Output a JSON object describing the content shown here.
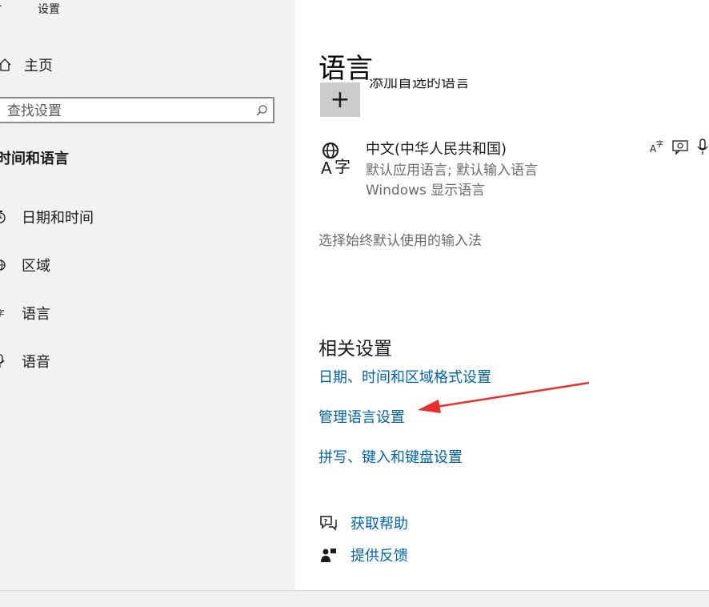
{
  "window": {
    "title": "设置"
  },
  "sidebar": {
    "home_label": "主页",
    "search_placeholder": "查找设置",
    "section_title": "时间和语言",
    "items": [
      {
        "label": "日期和时间",
        "icon": "clock-icon"
      },
      {
        "label": "区域",
        "icon": "globe-icon"
      },
      {
        "label": "语言",
        "icon": "language-icon"
      },
      {
        "label": "语音",
        "icon": "microphone-icon"
      }
    ]
  },
  "main": {
    "title": "语言",
    "add_language_label": "添加首选的语言",
    "language": {
      "name": "中文(中华人民共和国)",
      "sub1": "默认应用语言; 默认输入语言",
      "sub2": "Windows 显示语言"
    },
    "ime_link": "选择始终默认使用的输入法",
    "related_title": "相关设置",
    "related_links": [
      "日期、时间和区域格式设置",
      "管理语言设置",
      "拼写、键入和键盘设置"
    ],
    "help": [
      {
        "label": "获取帮助",
        "icon": "help-chat-icon"
      },
      {
        "label": "提供反馈",
        "icon": "feedback-icon"
      }
    ]
  },
  "colors": {
    "link": "#0063b1",
    "sidebar_bg": "#f2f2f2",
    "annotation_arrow": "#e8302a"
  }
}
